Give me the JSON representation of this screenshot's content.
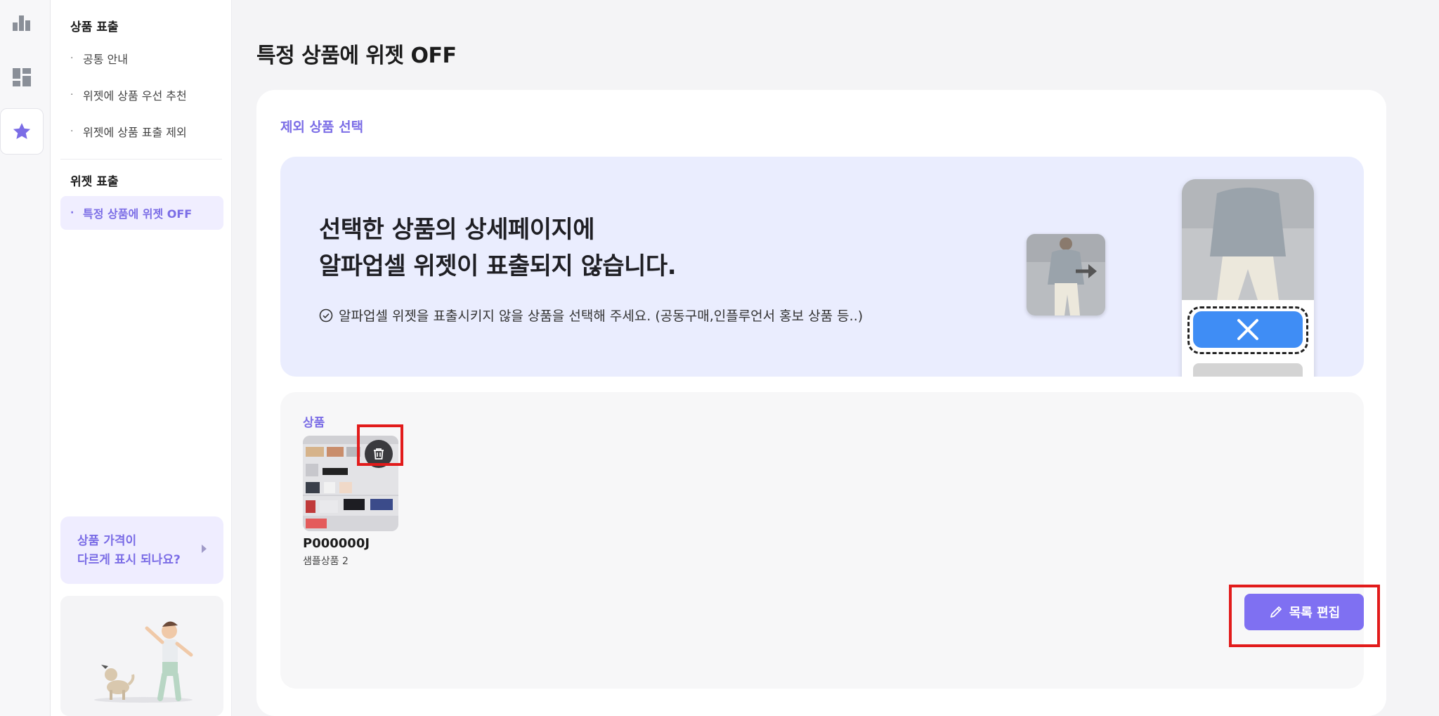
{
  "rail": {
    "icons": [
      "bar-chart-icon",
      "dashboard-icon",
      "star-icon"
    ]
  },
  "sidebar": {
    "section1_title": "상품 표출",
    "section1_items": [
      "공통 안내",
      "위젯에 상품 우선 추천",
      "위젯에 상품 표출 제외"
    ],
    "section2_title": "위젯 표출",
    "section2_items": [
      "특정 상품에 위젯 OFF"
    ],
    "help_line1": "상품 가격이",
    "help_line2": "다르게 표시 되나요?"
  },
  "page": {
    "title": "특정 상품에 위젯 OFF"
  },
  "selection": {
    "label": "제외 상품 선택",
    "banner_line1": "선택한 상품의 상세페이지에",
    "banner_line2": "알파업셀 위젯이 표출되지 않습니다.",
    "banner_note": "알파업셀 위젯을 표출시키지 않을 상품을 선택해 주세요. (공동구매,인플루언서 홍보 상품 등..)"
  },
  "products": {
    "label": "상품",
    "items": [
      {
        "code": "P000000J",
        "name": "샘플상품 2"
      }
    ],
    "edit_label": "목록 편집"
  },
  "colors": {
    "accent": "#7b6de6",
    "button": "#7f70f2",
    "highlight": "#e21b1b",
    "banner_bg": "#eaedfe"
  }
}
